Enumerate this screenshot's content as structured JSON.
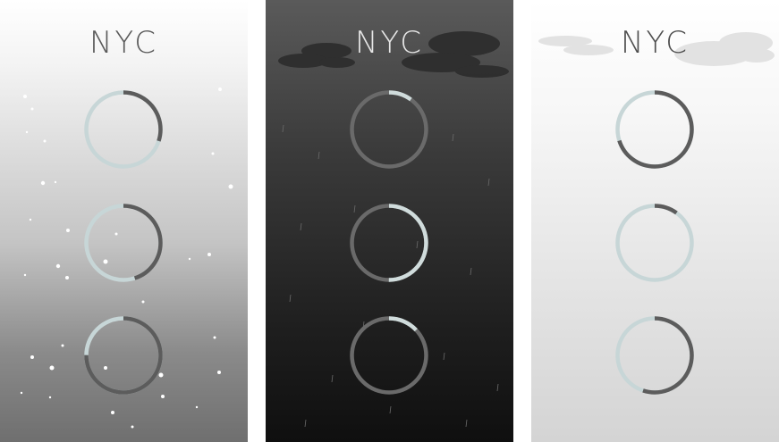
{
  "colors": {
    "track_light": "#c7d6d7",
    "arc_dark": "#5c5c5c",
    "rain_track": "#6a6a6a",
    "rain_arc": "#d0dcdc"
  },
  "panels": [
    {
      "id": "snow",
      "weather": "snow",
      "city": "NYC",
      "theme": "light-gradient",
      "rings": [
        {
          "progress": 0.3,
          "style": "light"
        },
        {
          "progress": 0.45,
          "style": "light"
        },
        {
          "progress": 0.75,
          "style": "light"
        }
      ]
    },
    {
      "id": "rain",
      "weather": "rain",
      "city": "NYC",
      "theme": "dark",
      "rings": [
        {
          "progress": 0.1,
          "style": "dark"
        },
        {
          "progress": 0.5,
          "style": "dark"
        },
        {
          "progress": 0.13,
          "style": "dark"
        }
      ]
    },
    {
      "id": "cloudy",
      "weather": "cloudy",
      "city": "NYC",
      "theme": "light",
      "rings": [
        {
          "progress": 0.7,
          "style": "cloudy"
        },
        {
          "progress": 0.1,
          "style": "cloudy"
        },
        {
          "progress": 0.55,
          "style": "cloudy"
        }
      ]
    }
  ]
}
